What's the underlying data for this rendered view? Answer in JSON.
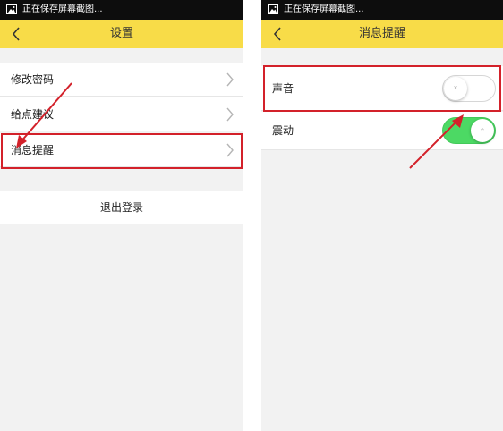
{
  "colors": {
    "accent_yellow": "#f8dc48",
    "highlight_red": "#d3212a",
    "toggle_on_green": "#4cd964",
    "statusbar_black": "#0d0d0d"
  },
  "left_screen": {
    "statusbar": {
      "icon": "image-icon",
      "text": "正在保存屏幕截图..."
    },
    "titlebar": {
      "back_icon": "back-chevron-icon",
      "title": "设置"
    },
    "items": [
      {
        "label": "修改密码",
        "icon": "chevron-right-icon"
      },
      {
        "label": "给点建议",
        "icon": "chevron-right-icon"
      },
      {
        "label": "消息提醒",
        "icon": "chevron-right-icon",
        "highlighted": true
      }
    ],
    "logout_label": "退出登录"
  },
  "right_screen": {
    "statusbar": {
      "icon": "image-icon",
      "text": "正在保存屏幕截图..."
    },
    "titlebar": {
      "back_icon": "back-chevron-icon",
      "title": "消息提醒"
    },
    "settings": [
      {
        "label": "声音",
        "enabled": false,
        "knob_mark": "×",
        "highlighted": true
      },
      {
        "label": "震动",
        "enabled": true,
        "knob_mark": "ᴖ"
      }
    ]
  }
}
